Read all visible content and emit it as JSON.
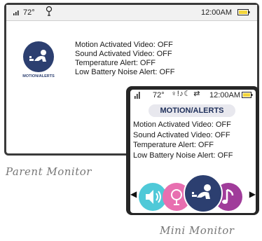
{
  "parent_monitor": {
    "status": {
      "temperature": "72°",
      "time": "12:00AM"
    },
    "icon_label": "MOTION/ALERTS",
    "lines": [
      "Motion Activated Video: OFF",
      "Sound Activated Video: OFF",
      "Temperature Alert: OFF",
      "Low Battery Noise Alert: OFF"
    ]
  },
  "mini_monitor": {
    "status": {
      "temperature": "72°",
      "icons": "♀!♪☾ ⇄",
      "time": "12:00AM"
    },
    "title": "MOTION/ALERTS",
    "lines": [
      "Motion Activated Video: OFF",
      "Sound Activated Video: OFF",
      "Temperature Alert: OFF",
      "Low Battery Noise Alert: OFF"
    ],
    "carousel": [
      {
        "icon": "speaker-icon",
        "color": "#4fc9d8"
      },
      {
        "icon": "thermometer-icon",
        "color": "#e86fb0"
      },
      {
        "icon": "baby-motion-icon",
        "color": "#2c3f70"
      },
      {
        "icon": "music-note-icon",
        "color": "#a03c9a"
      }
    ]
  },
  "captions": {
    "parent": "Parent Monitor",
    "mini": "Mini Monitor"
  }
}
